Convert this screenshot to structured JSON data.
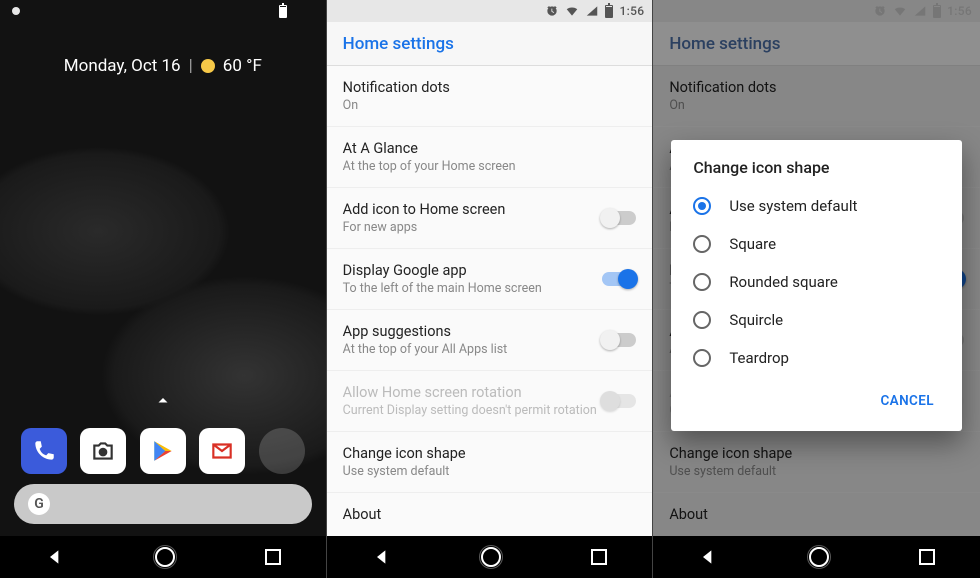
{
  "status": {
    "time": "1:56"
  },
  "home": {
    "glance_date": "Monday, Oct 16",
    "glance_temp": "60 °F",
    "search_letter": "G",
    "dock": [
      {
        "name": "phone"
      },
      {
        "name": "camera"
      },
      {
        "name": "play-store"
      },
      {
        "name": "gmail"
      },
      {
        "name": "folder"
      }
    ]
  },
  "settings": {
    "header": "Home settings",
    "items": [
      {
        "title": "Notification dots",
        "sub": "On",
        "toggle": null
      },
      {
        "title": "At A Glance",
        "sub": "At the top of your Home screen",
        "toggle": null
      },
      {
        "title": "Add icon to Home screen",
        "sub": "For new apps",
        "toggle": "off"
      },
      {
        "title": "Display Google app",
        "sub": "To the left of the main Home screen",
        "toggle": "on"
      },
      {
        "title": "App suggestions",
        "sub": "At the top of your All Apps list",
        "toggle": "off"
      },
      {
        "title": "Allow Home screen rotation",
        "sub": "Current Display setting doesn't permit rotation",
        "toggle": "disabled"
      },
      {
        "title": "Change icon shape",
        "sub": "Use system default",
        "toggle": null
      },
      {
        "title": "About",
        "sub": "",
        "toggle": null
      }
    ]
  },
  "dialog": {
    "title": "Change icon shape",
    "options": [
      "Use system default",
      "Square",
      "Rounded square",
      "Squircle",
      "Teardrop"
    ],
    "selected": 0,
    "cancel": "CANCEL"
  }
}
